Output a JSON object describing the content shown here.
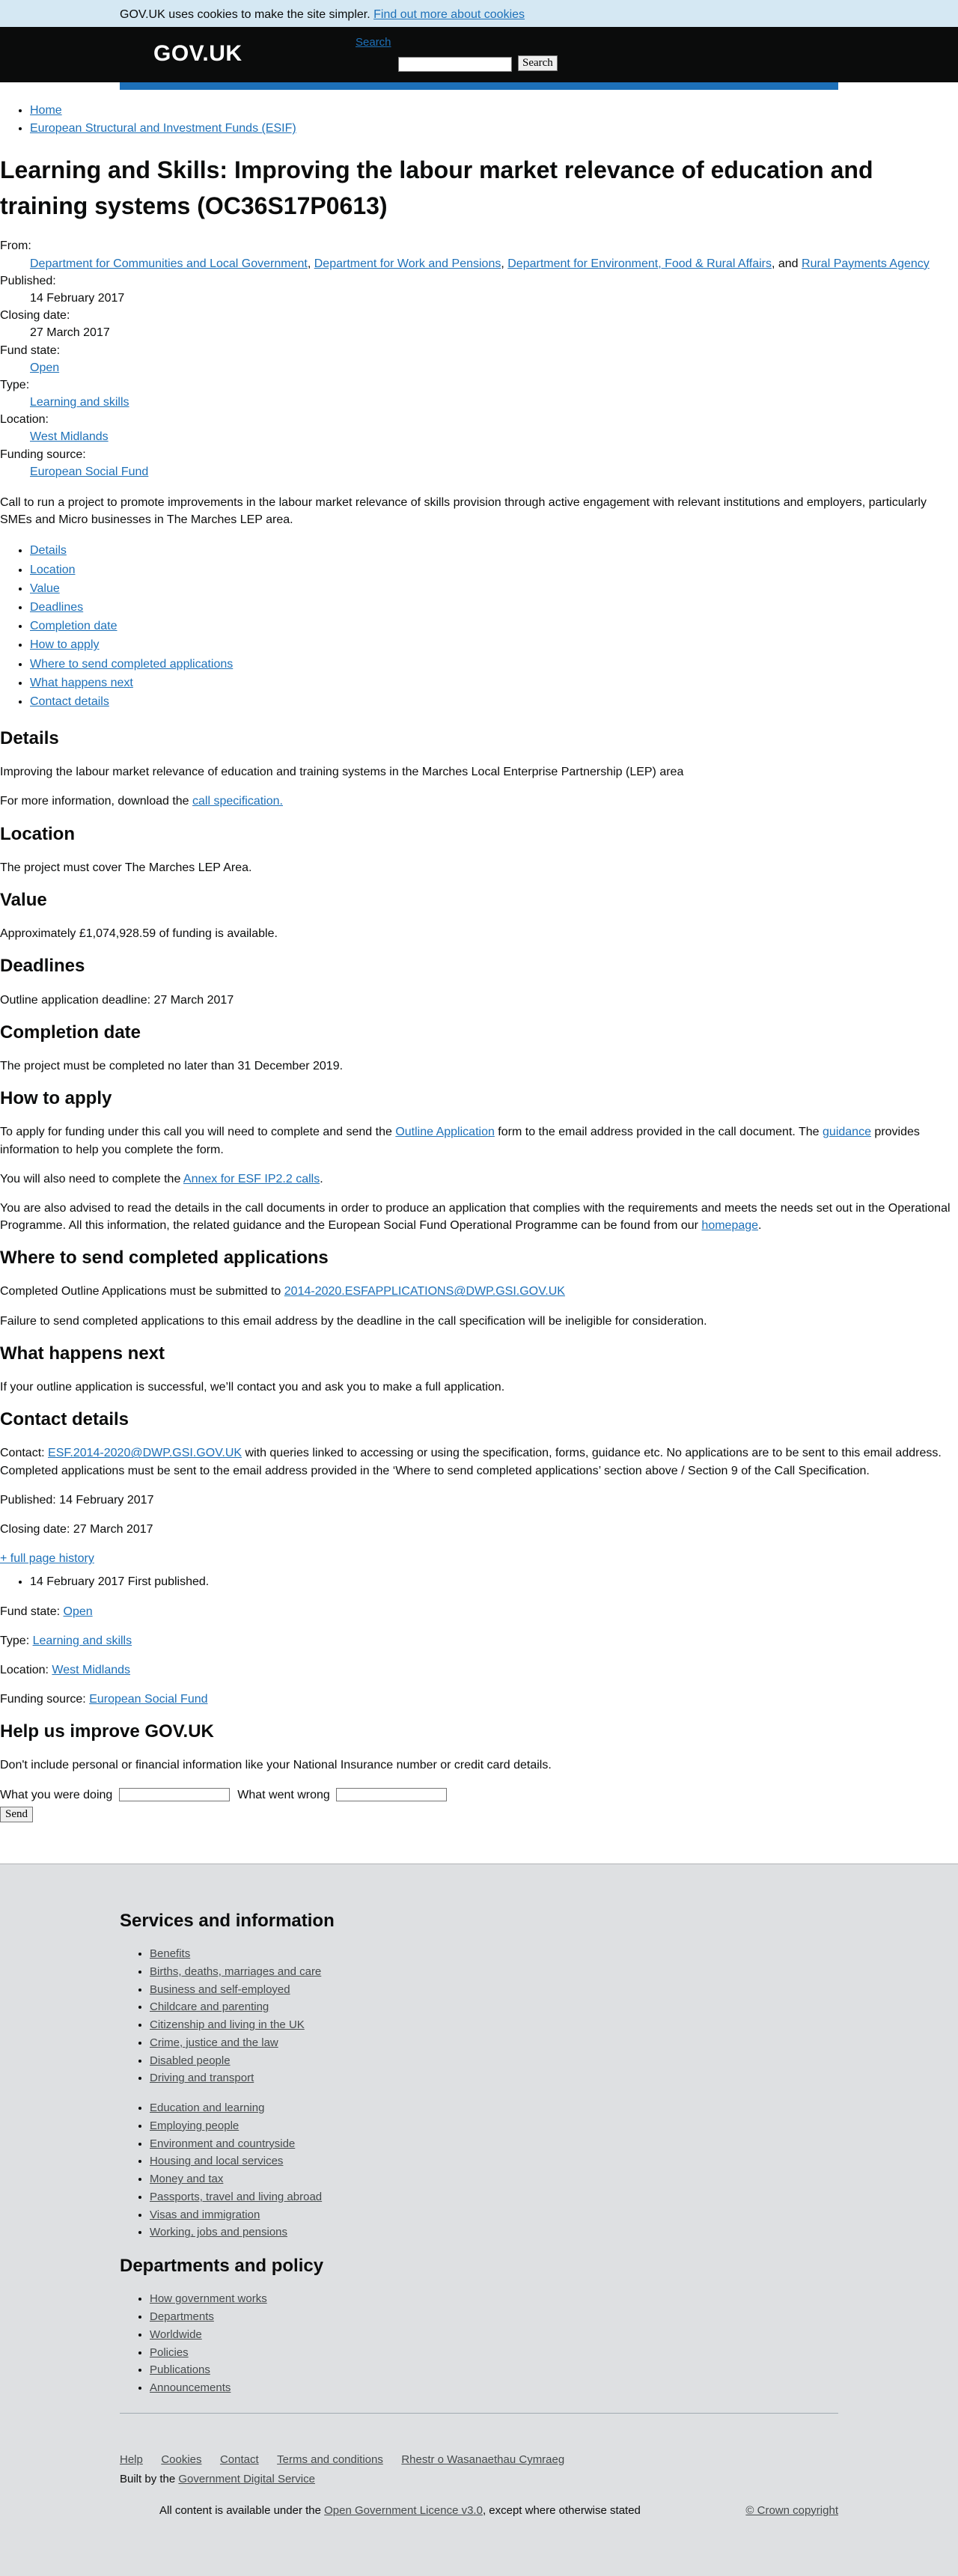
{
  "cookie_banner": {
    "text": "GOV.UK uses cookies to make the site simpler.",
    "link": "Find out more about cookies"
  },
  "header": {
    "logo": "GOV.UK",
    "search_toggle": "Search",
    "search_button": "Search"
  },
  "breadcrumbs": [
    "Home",
    "European Structural and Investment Funds (ESIF)"
  ],
  "title": "Learning and Skills: Improving the labour market relevance of education and training systems (OC36S17P0613)",
  "meta": {
    "from_label": "From:",
    "from_links": [
      "Department for Communities and Local Government",
      "Department for Work and Pensions",
      "Department for Environment, Food & Rural Affairs",
      "Rural Payments Agency"
    ],
    "from_sep1": ", ",
    "from_sep2": ", ",
    "from_sep3": ", and ",
    "published_label": "Published:",
    "published": "14 February 2017",
    "closing_label": "Closing date:",
    "closing": "27 March 2017",
    "fund_state_label": "Fund state:",
    "fund_state": "Open",
    "type_label": "Type:",
    "type": "Learning and skills",
    "location_label": "Location:",
    "location": "West Midlands",
    "funding_source_label": "Funding source:",
    "funding_source": "European Social Fund"
  },
  "summary": "Call to run a project to promote improvements in the labour market relevance of skills provision through active engagement with relevant institutions and employers, particularly SMEs and Micro businesses in The Marches LEP area.",
  "contents": [
    "Details",
    "Location",
    "Value",
    "Deadlines",
    "Completion date",
    "How to apply",
    "Where to send completed applications",
    "What happens next",
    "Contact details"
  ],
  "details": {
    "heading": "Details",
    "p1": "Improving the labour market relevance of education and training systems in the Marches Local Enterprise Partnership (LEP) area",
    "p2_pre": "For more information, download the ",
    "p2_link": "call specification."
  },
  "location": {
    "heading": "Location",
    "p1": "The project must cover The Marches LEP Area."
  },
  "value": {
    "heading": "Value",
    "p1": "Approximately £1,074,928.59 of funding is available."
  },
  "deadlines": {
    "heading": "Deadlines",
    "p1": "Outline application deadline: 27 March 2017"
  },
  "completion": {
    "heading": "Completion date",
    "p1": "The project must be completed no later than 31 December 2019."
  },
  "how_to_apply": {
    "heading": "How to apply",
    "p1_pre": "To apply for funding under this call you will need to complete and send the ",
    "p1_link1": "Outline Application",
    "p1_mid": " form to the email address provided in the call document. The ",
    "p1_link2": "guidance",
    "p1_post": " provides information to help you complete the form.",
    "p2_pre": "You will also need to complete the ",
    "p2_link": "Annex for ESF IP2.2 calls",
    "p2_post": ".",
    "p3_pre": "You are also advised to read the details in the call documents in order to produce an application that complies with the requirements and meets the needs set out in the Operational Programme. All this information, the related guidance and the European Social Fund Operational Programme can be found from our ",
    "p3_link": "homepage",
    "p3_post": "."
  },
  "where_to_send": {
    "heading": "Where to send completed applications",
    "p1_pre": "Completed Outline Applications must be submitted to ",
    "p1_link": "2014-2020.ESFAPPLICATIONS@DWP.GSI.GOV.UK",
    "p2": "Failure to send completed applications to this email address by the deadline in the call specification will be ineligible for consideration."
  },
  "what_next": {
    "heading": "What happens next",
    "p1": "If your outline application is successful, we’ll contact you and ask you to make a full application."
  },
  "contact": {
    "heading": "Contact details",
    "p1_pre": "Contact: ",
    "p1_link": "ESF.2014-2020@DWP.GSI.GOV.UK",
    "p1_post": " with queries linked to accessing or using the specification, forms, guidance etc. No applications are to be sent to this email address. Completed applications must be sent to the email address provided in the ‘Where to send completed applications’ section above / Section 9 of the Call Specification."
  },
  "footer_meta": {
    "published": "Published: 14 February 2017",
    "closing": "Closing date: 27 March 2017",
    "history_link": "+ full page history",
    "history_item": "14 February 2017 First published.",
    "fund_state_label": "Fund state: ",
    "fund_state": "Open",
    "type_label": "Type: ",
    "type": "Learning and skills",
    "location_label": "Location: ",
    "location": "West Midlands",
    "funding_label": "Funding source: ",
    "funding": "European Social Fund"
  },
  "feedback": {
    "heading": "Help us improve GOV.UK",
    "note": "Don't include personal or financial information like your National Insurance number or credit card details.",
    "doing_label": "What you were doing",
    "wrong_label": "What went wrong",
    "send": "Send"
  },
  "footer": {
    "services_heading": "Services and information",
    "services_col1": [
      "Benefits",
      "Births, deaths, marriages and care",
      "Business and self-employed",
      "Childcare and parenting",
      "Citizenship and living in the UK",
      "Crime, justice and the law",
      "Disabled people",
      "Driving and transport"
    ],
    "services_col2": [
      "Education and learning",
      "Employing people",
      "Environment and countryside",
      "Housing and local services",
      "Money and tax",
      "Passports, travel and living abroad",
      "Visas and immigration",
      "Working, jobs and pensions"
    ],
    "departments_heading": "Departments and policy",
    "departments": [
      "How government works",
      "Departments",
      "Worldwide",
      "Policies",
      "Publications",
      "Announcements"
    ],
    "meta_links": [
      "Help",
      "Cookies",
      "Contact",
      "Terms and conditions",
      "Rhestr o Wasanaethau Cymraeg"
    ],
    "built_by_pre": "Built by the ",
    "built_by_link": "Government Digital Service",
    "licence_pre": "All content is available under the ",
    "licence_link": "Open Government Licence v3.0",
    "licence_post": ", except where otherwise stated",
    "copyright": "© Crown copyright"
  }
}
